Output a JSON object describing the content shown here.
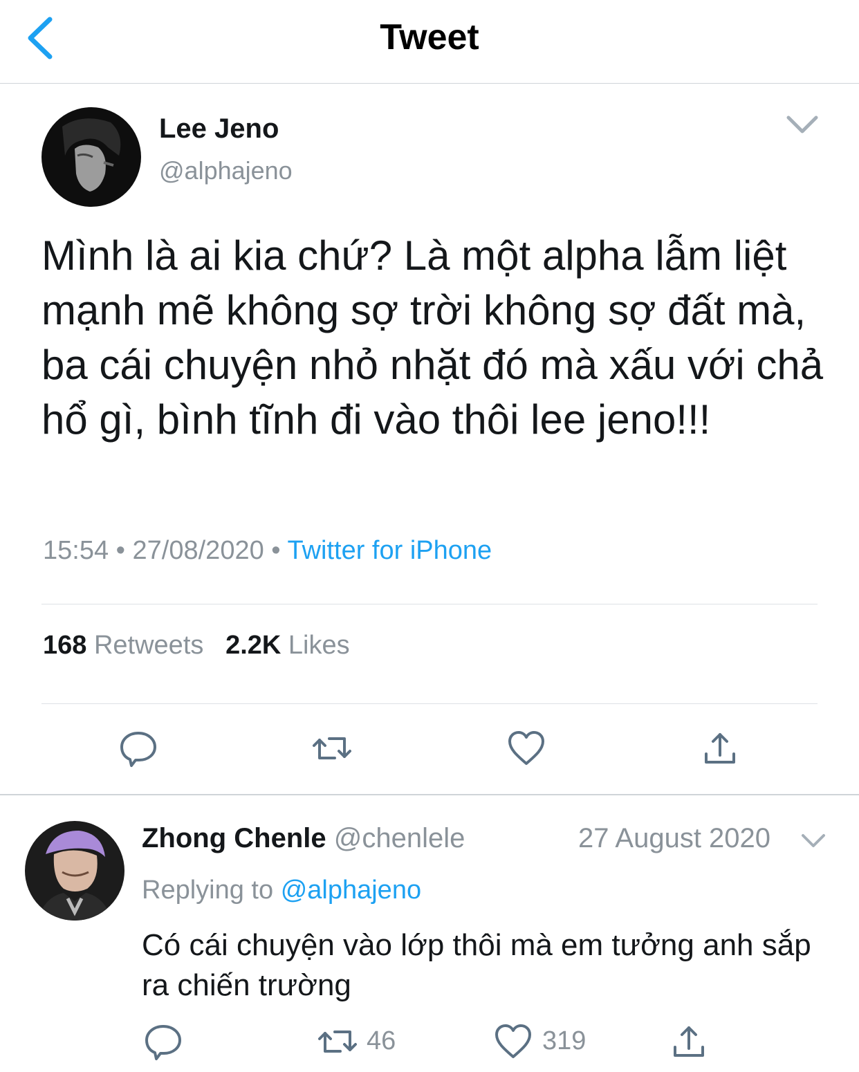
{
  "header": {
    "title": "Tweet",
    "back_icon": "chevron-left-icon"
  },
  "tweet": {
    "author_name": "Lee Jeno",
    "author_handle": "@alphajeno",
    "text": "Mình là ai kia chứ? Là một alpha lẫm liệt mạnh mẽ không sợ trời không sợ đất mà, ba cái chuyện nhỏ nhặt đó mà xấu với chả hổ gì, bình tĩnh đi vào thôi lee jeno!!!",
    "time": "15:54",
    "date": "27/08/2020",
    "separator": "•",
    "source": "Twitter for iPhone",
    "retweets_count": "168",
    "retweets_label": "Retweets",
    "likes_count": "2.2K",
    "likes_label": "Likes"
  },
  "reply": {
    "author_name": "Zhong Chenle",
    "author_handle": "@chenlele",
    "date": "27 August 2020",
    "replying_prefix": "Replying to",
    "replying_handle": "@alphajeno",
    "text": "Có cái chuyện vào lớp thôi mà em tưởng anh sắp ra chiến trường",
    "retweet_count": "46",
    "like_count": "319"
  },
  "colors": {
    "accent": "#1da1f2",
    "text": "#14171a",
    "secondary": "#8a9299",
    "icon": "#5b7083"
  }
}
